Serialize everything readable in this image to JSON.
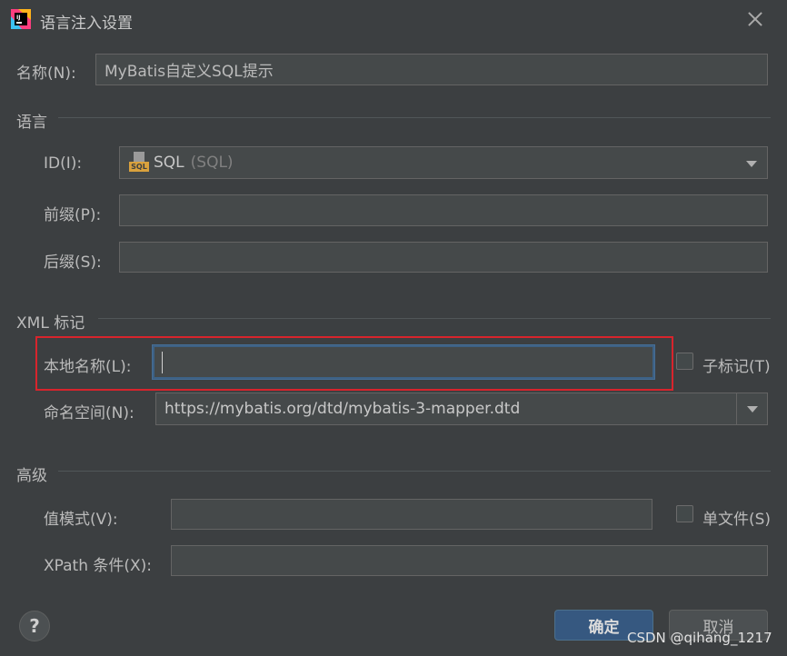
{
  "window": {
    "title": "语言注入设置",
    "app_icon": "intellij-idea-icon"
  },
  "name_field": {
    "label": "名称(N):",
    "value": "MyBatis自定义SQL提示"
  },
  "language_section": {
    "title": "语言",
    "id_label": "ID(I):",
    "id_value": "SQL",
    "id_hint": "(SQL)",
    "prefix_label": "前缀(P):",
    "prefix_value": "",
    "suffix_label": "后缀(S):",
    "suffix_value": ""
  },
  "xml_section": {
    "title": "XML 标记",
    "local_name_label": "本地名称(L):",
    "local_name_value": "",
    "sub_tag_label": "子标记(T)",
    "namespace_label": "命名空间(N):",
    "namespace_value": "https://mybatis.org/dtd/mybatis-3-mapper.dtd"
  },
  "advanced_section": {
    "title": "高级",
    "value_pattern_label": "值模式(V):",
    "value_pattern_value": "",
    "single_file_label": "单文件(S)",
    "xpath_label": "XPath 条件(X):",
    "xpath_value": ""
  },
  "footer": {
    "ok_label": "确定",
    "cancel_label": "取消",
    "help_label": "?"
  },
  "watermark": "CSDN @qihang_1217",
  "colors": {
    "background": "#3c3f41",
    "field": "#45494a",
    "primary_button": "#365880",
    "highlight_box": "#d8242c",
    "focus": "#3d6185"
  }
}
